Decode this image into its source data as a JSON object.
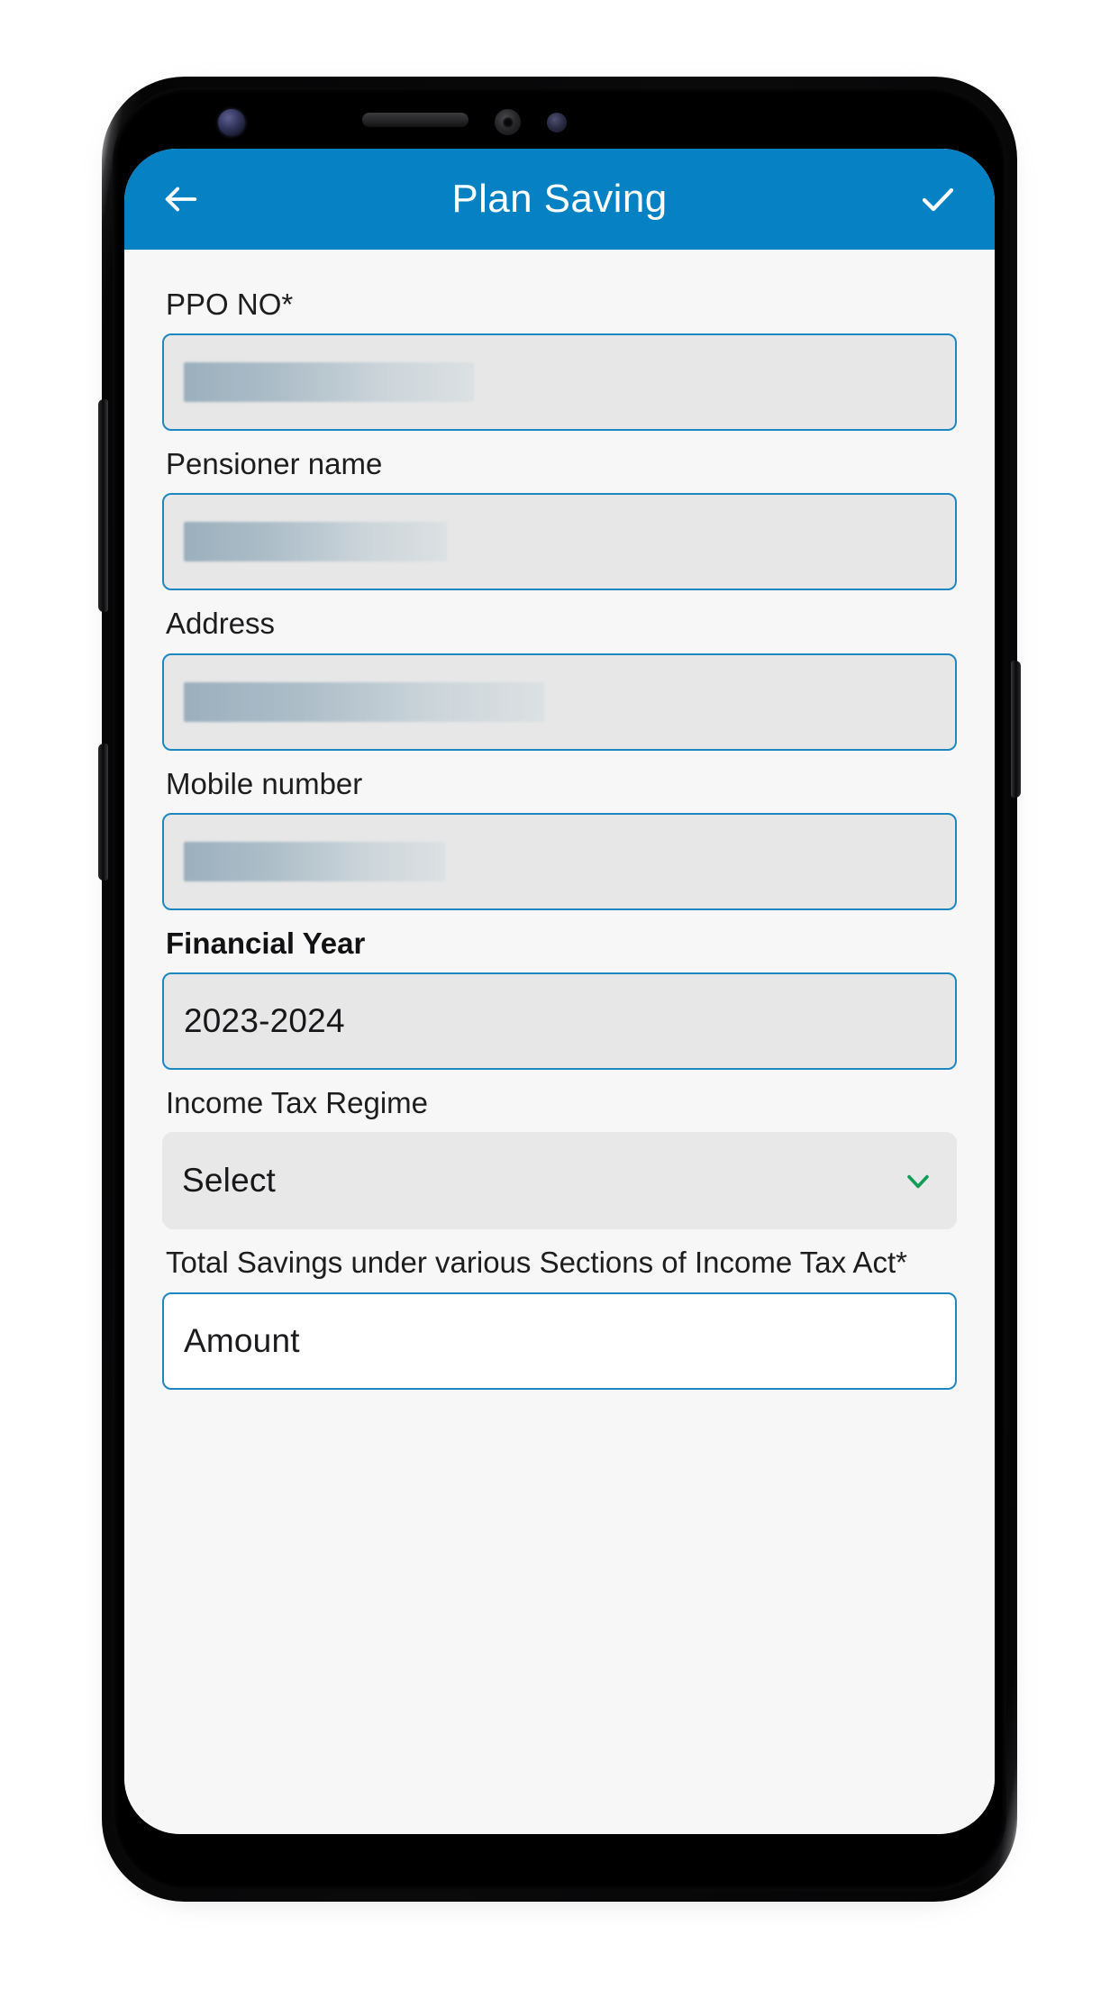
{
  "device": {
    "frame_label": "samsung-galaxy-phone-mockup",
    "hardware": {
      "volume_button": "volume-button",
      "bixby_button": "assistant-button",
      "power_button": "power-button",
      "front_camera": "front-camera",
      "earpiece_speaker": "earpiece-speaker",
      "iris_scanner": "iris-scanner",
      "proximity_sensor": "proximity-sensor"
    }
  },
  "app_bar": {
    "title": "Plan Saving",
    "back_icon": "back-arrow-icon",
    "submit_icon": "checkmark-icon",
    "background_color": "#0581c4",
    "text_color": "#ffffff"
  },
  "theme": {
    "screen_background": "#f7f7f7",
    "field_border_color": "#1f87c0",
    "field_fill_color": "#e7e7e7",
    "chevron_color": "#0f9d58",
    "label_color": "#1d1d1f"
  },
  "form": {
    "fields": [
      {
        "name": "ppo-no",
        "label": "PPO NO*",
        "label_emphasis": false,
        "type": "text",
        "value": "",
        "value_redacted": true,
        "redaction_width": "w-ppo",
        "bordered": true,
        "background": "#e7e7e7"
      },
      {
        "name": "pensioner-name",
        "label": "Pensioner name",
        "label_emphasis": false,
        "type": "text",
        "value": "",
        "value_redacted": true,
        "redaction_width": "w-name",
        "bordered": true,
        "background": "#e7e7e7"
      },
      {
        "name": "address",
        "label": "Address",
        "label_emphasis": false,
        "type": "text",
        "value": "",
        "value_redacted": true,
        "redaction_width": "w-addr",
        "bordered": true,
        "background": "#e7e7e7"
      },
      {
        "name": "mobile-number",
        "label": "Mobile number",
        "label_emphasis": false,
        "type": "tel",
        "value": "",
        "value_redacted": true,
        "redaction_width": "w-mobile",
        "bordered": true,
        "background": "#e7e7e7"
      },
      {
        "name": "financial-year",
        "label": "Financial Year",
        "label_emphasis": true,
        "type": "text",
        "value": "2023-2024",
        "value_redacted": false,
        "bordered": true,
        "background": "#e7e7e7"
      },
      {
        "name": "income-tax-regime",
        "label": "Income Tax Regime",
        "label_emphasis": false,
        "type": "select",
        "value": "Select",
        "value_redacted": false,
        "bordered": false,
        "background": "#e8e8e8",
        "chevron_icon": "chevron-down-icon"
      },
      {
        "name": "total-savings",
        "label": "Total Savings under various Sections of Income Tax Act*",
        "label_emphasis": false,
        "type": "number",
        "value": "Amount",
        "value_is_placeholder": true,
        "value_redacted": false,
        "bordered": true,
        "background": "#ffffff"
      }
    ]
  }
}
